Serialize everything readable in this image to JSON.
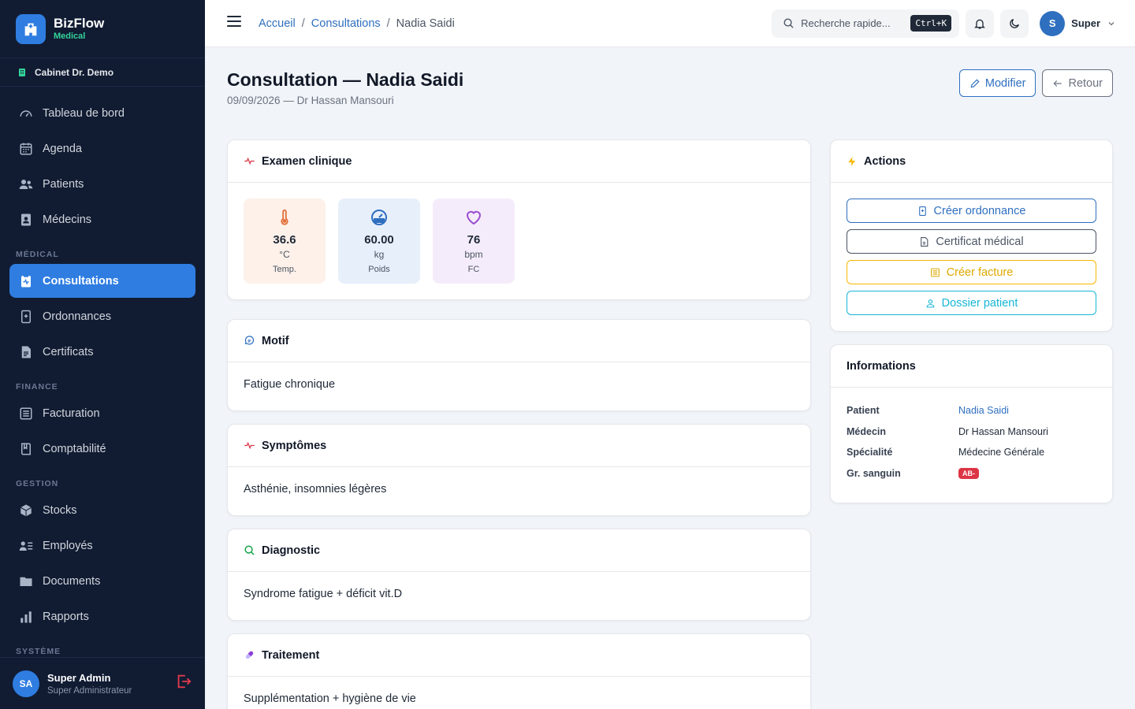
{
  "brand": {
    "name": "BizFlow",
    "sub": "Medical"
  },
  "clinic": "Cabinet Dr. Demo",
  "nav": {
    "tableau": "Tableau de bord",
    "agenda": "Agenda",
    "patients": "Patients",
    "medecins": "Médecins",
    "section_medical": "MÉDICAL",
    "consultations": "Consultations",
    "ordonnances": "Ordonnances",
    "certificats": "Certificats",
    "section_finance": "FINANCE",
    "facturation": "Facturation",
    "comptabilite": "Comptabilité",
    "section_gestion": "GESTION",
    "stocks": "Stocks",
    "employes": "Employés",
    "documents": "Documents",
    "rapports": "Rapports",
    "section_systeme": "SYSTÈME"
  },
  "sidebar_user": {
    "initials": "SA",
    "name": "Super Admin",
    "role": "Super Administrateur"
  },
  "breadcrumb": {
    "home": "Accueil",
    "section": "Consultations",
    "current": "Nadia Saidi",
    "sep": "/"
  },
  "search": {
    "placeholder": "Recherche rapide...",
    "shortcut": "Ctrl+K"
  },
  "top_user": {
    "initial": "S",
    "name": "Super"
  },
  "page": {
    "title": "Consultation — Nadia Saidi",
    "subtitle": "09/09/2026 — Dr Hassan Mansouri"
  },
  "buttons": {
    "modifier": "Modifier",
    "retour": "Retour"
  },
  "examen": {
    "title": "Examen clinique",
    "vitals": [
      {
        "value": "36.6",
        "unit": "°C",
        "label": "Temp.",
        "bg": "#fdf1ea",
        "color": "#e2703a"
      },
      {
        "value": "60.00",
        "unit": "kg",
        "label": "Poids",
        "bg": "#e7effb",
        "color": "#2f6fbf"
      },
      {
        "value": "76",
        "unit": "bpm",
        "label": "FC",
        "bg": "#f5ecfb",
        "color": "#9b4fd0"
      }
    ]
  },
  "motif": {
    "title": "Motif",
    "text": "Fatigue chronique"
  },
  "symptomes": {
    "title": "Symptômes",
    "text": "Asthénie, insomnies légères"
  },
  "diagnostic": {
    "title": "Diagnostic",
    "text": "Syndrome fatigue + déficit vit.D"
  },
  "traitement": {
    "title": "Traitement",
    "text": "Supplémentation + hygiène de vie"
  },
  "actions": {
    "title": "Actions",
    "ordonnance": "Créer ordonnance",
    "certificat": "Certificat médical",
    "facture": "Créer facture",
    "dossier": "Dossier patient"
  },
  "informations": {
    "title": "Informations",
    "patient_label": "Patient",
    "patient_value": "Nadia Saidi",
    "medecin_label": "Médecin",
    "medecin_value": "Dr Hassan Mansouri",
    "specialite_label": "Spécialité",
    "specialite_value": "Médecine Générale",
    "groupe_label": "Gr. sanguin",
    "groupe_value": "AB-"
  },
  "colors": {
    "primary": "#2f7de1",
    "sidebar": "#111c33",
    "warning": "#f5b800",
    "info": "#17b6d6",
    "danger": "#dc3545"
  }
}
